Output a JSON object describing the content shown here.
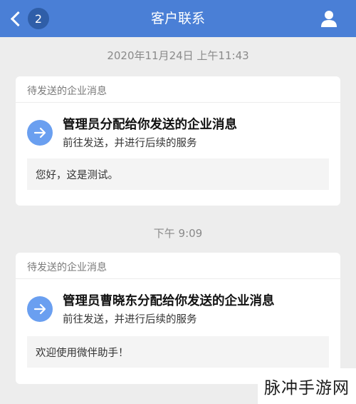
{
  "navbar": {
    "back_badge": "2",
    "title": "客户联系"
  },
  "messages": [
    {
      "timestamp": "2020年11月24日 上午11:43",
      "header": "待发送的企业消息",
      "title": "管理员分配给你发送的企业消息",
      "subtitle": "前往发送，并进行后续的服务",
      "content": "您好，这是测试。"
    },
    {
      "timestamp": "下午 9:09",
      "header": "待发送的企业消息",
      "title": "管理员曹晓东分配给你发送的企业消息",
      "subtitle": "前往发送，并进行后续的服务",
      "content": "欢迎使用微伴助手！"
    }
  ],
  "watermark": "脉冲手游网",
  "colors": {
    "navbar": "#4a7fd6",
    "accent_circle": "#6a9ff0",
    "background": "#ededed"
  }
}
